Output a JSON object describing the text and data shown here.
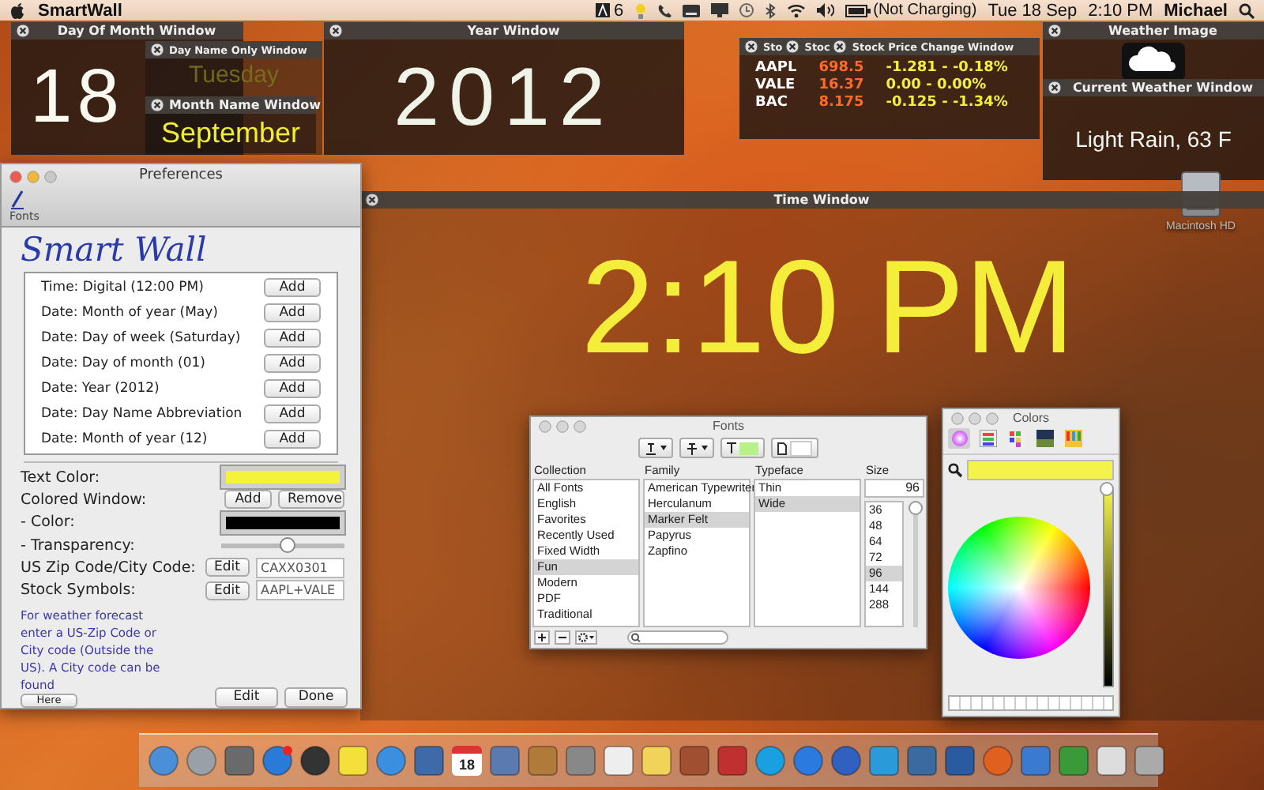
{
  "menu_bar": {
    "app_name": "SmartWall",
    "badge": "6",
    "battery_status": "(Not Charging)",
    "date": "Tue 18 Sep",
    "time": "2:10 PM",
    "user": "Michael"
  },
  "widgets": {
    "day_of_month": {
      "title": "Day Of Month Window",
      "value": "18"
    },
    "day_name": {
      "title": "Day Name Only Window",
      "value": "Tuesday"
    },
    "month_name": {
      "title": "Month Name Window",
      "value": "September"
    },
    "year": {
      "title": "Year Window",
      "value": "2012"
    },
    "stocks": {
      "titles": [
        "Sto",
        "Stoc",
        "Stock Price Change Window"
      ],
      "rows": [
        {
          "symbol": "AAPL",
          "price": "698.5",
          "change": "-1.281 - -0.18%"
        },
        {
          "symbol": "VALE",
          "price": "16.37",
          "change": "0.00 - 0.00%"
        },
        {
          "symbol": "BAC",
          "price": "8.175",
          "change": "-0.125 - -1.34%"
        }
      ]
    },
    "weather_image": {
      "title": "Weather Image"
    },
    "current_weather": {
      "title": "Current Weather Window",
      "value": "Light Rain, 63 F"
    },
    "time": {
      "title": "Time Window",
      "value": "2:10 PM"
    }
  },
  "desktop_icons": [
    {
      "label": "Macintosh HD"
    }
  ],
  "preferences": {
    "title": "Preferences",
    "toolbar_item": "Fonts",
    "heading": "Smart Wall",
    "items": [
      {
        "label": "Time: Digital (12:00 PM)",
        "button": "Add"
      },
      {
        "label": "Date: Month of year (May)",
        "button": "Add"
      },
      {
        "label": "Date: Day of week (Saturday)",
        "button": "Add"
      },
      {
        "label": "Date: Day of month (01)",
        "button": "Add"
      },
      {
        "label": "Date: Year (2012)",
        "button": "Add"
      },
      {
        "label": "Date: Day Name Abbreviation",
        "button": "Add"
      },
      {
        "label": "Date: Month of year (12)",
        "button": "Add"
      }
    ],
    "text_color": {
      "label": "Text Color:",
      "color": "#f4f33c"
    },
    "colored_window": {
      "label": "Colored Window:",
      "buttons": [
        "Add",
        "Remove"
      ]
    },
    "window_color": {
      "label": "- Color:",
      "color": "#000000"
    },
    "transparency": {
      "label": "- Transparency:",
      "level": 0.55
    },
    "zip_code": {
      "label": "US Zip Code/City Code:",
      "button": "Edit",
      "value": "CAXX0301"
    },
    "stock_symbols": {
      "label": "Stock Symbols:",
      "button": "Edit",
      "value": "AAPL+VALE"
    },
    "note": "For weather forecast enter a US-Zip Code or City code (Outside the US). A City code can be found",
    "here_button": "Here",
    "buttons": [
      "Edit",
      "Done"
    ]
  },
  "fonts_panel": {
    "title": "Fonts",
    "collection": {
      "header": "Collection",
      "items": [
        {
          "label": "All Fonts",
          "selected": false
        },
        {
          "label": "English",
          "selected": false
        },
        {
          "label": "Favorites",
          "selected": false
        },
        {
          "label": "Recently Used",
          "selected": false
        },
        {
          "label": "Fixed Width",
          "selected": false
        },
        {
          "label": "Fun",
          "selected": true
        },
        {
          "label": "Modern",
          "selected": false
        },
        {
          "label": "PDF",
          "selected": false
        },
        {
          "label": "Traditional",
          "selected": false
        }
      ]
    },
    "family": {
      "header": "Family",
      "items": [
        {
          "label": "American Typewriter",
          "selected": false
        },
        {
          "label": "Herculanum",
          "selected": false
        },
        {
          "label": "Marker Felt",
          "selected": true
        },
        {
          "label": "Papyrus",
          "selected": false
        },
        {
          "label": "Zapfino",
          "selected": false
        }
      ]
    },
    "typeface": {
      "header": "Typeface",
      "items": [
        {
          "label": "Thin",
          "selected": false
        },
        {
          "label": "Wide",
          "selected": true
        }
      ]
    },
    "size": {
      "header": "Size",
      "value": "96",
      "items": [
        {
          "label": "36",
          "selected": false
        },
        {
          "label": "48",
          "selected": false
        },
        {
          "label": "64",
          "selected": false
        },
        {
          "label": "72",
          "selected": false
        },
        {
          "label": "96",
          "selected": true
        },
        {
          "label": "144",
          "selected": false
        },
        {
          "label": "288",
          "selected": false
        }
      ],
      "level": 1
    }
  },
  "colors_panel": {
    "title": "Colors",
    "modes": [
      {
        "selected": true
      },
      {
        "selected": false
      },
      {
        "selected": false
      },
      {
        "selected": false
      },
      {
        "selected": false
      }
    ],
    "brightness": {
      "level": 1
    }
  },
  "dock": {
    "calendar_day": "18"
  }
}
